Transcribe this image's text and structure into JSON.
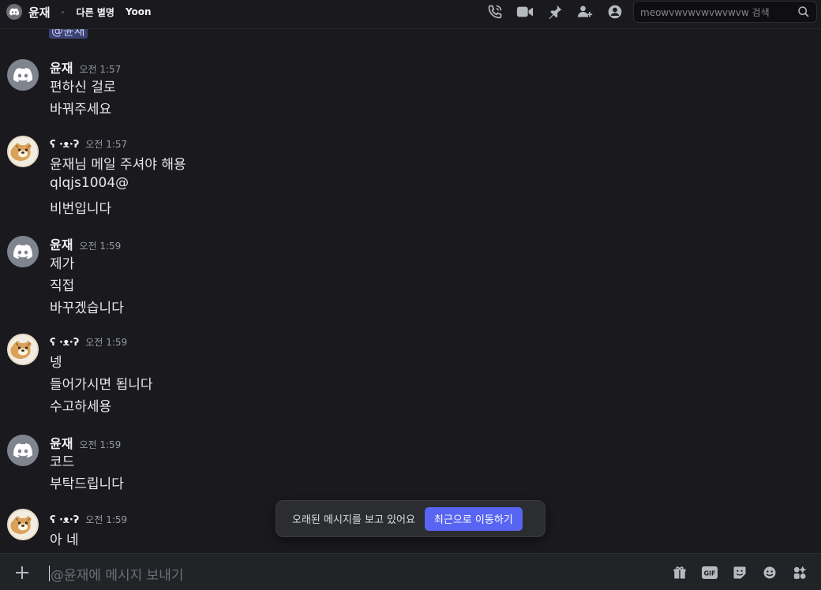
{
  "header": {
    "title": "윤재",
    "alias_label": "다른 별명",
    "alias": "Yoon",
    "search_placeholder": "meowvwvwvwvwvwvw 검색"
  },
  "mention_tag": "@윤재",
  "messages": [
    {
      "author": "윤재",
      "time": "오전 1:57",
      "avatar": "discord",
      "lines": [
        "편하신 걸로",
        "바꿔주세요"
      ]
    },
    {
      "author": "ʕ ·ᴥ·ʔ",
      "time": "오전 1:57",
      "avatar": "dog",
      "lines": [
        "윤재님 메일 주셔야 해용",
        "qlqjs1004@",
        "비번입니다"
      ]
    },
    {
      "author": "윤재",
      "time": "오전 1:59",
      "avatar": "discord",
      "lines": [
        "제가",
        "직접",
        "바꾸겠습니다"
      ]
    },
    {
      "author": "ʕ ·ᴥ·ʔ",
      "time": "오전 1:59",
      "avatar": "dog",
      "lines": [
        "넹",
        "들어가시면 됩니다",
        "수고하세용"
      ]
    },
    {
      "author": "윤재",
      "time": "오전 1:59",
      "avatar": "discord",
      "lines": [
        "코드",
        "부탁드립니다"
      ]
    },
    {
      "author": "ʕ ·ᴥ·ʔ",
      "time": "오전 1:59",
      "avatar": "dog",
      "lines": [
        "아 네"
      ]
    }
  ],
  "toast": {
    "text": "오래된 메시지를 보고 있어요",
    "button": "최근으로 이동하기"
  },
  "composer": {
    "placeholder": "@윤재에 메시지 보내기"
  },
  "colors": {
    "background": "#1a1a1e",
    "accent": "#5865f2",
    "mention_bg": "#3c4270"
  }
}
